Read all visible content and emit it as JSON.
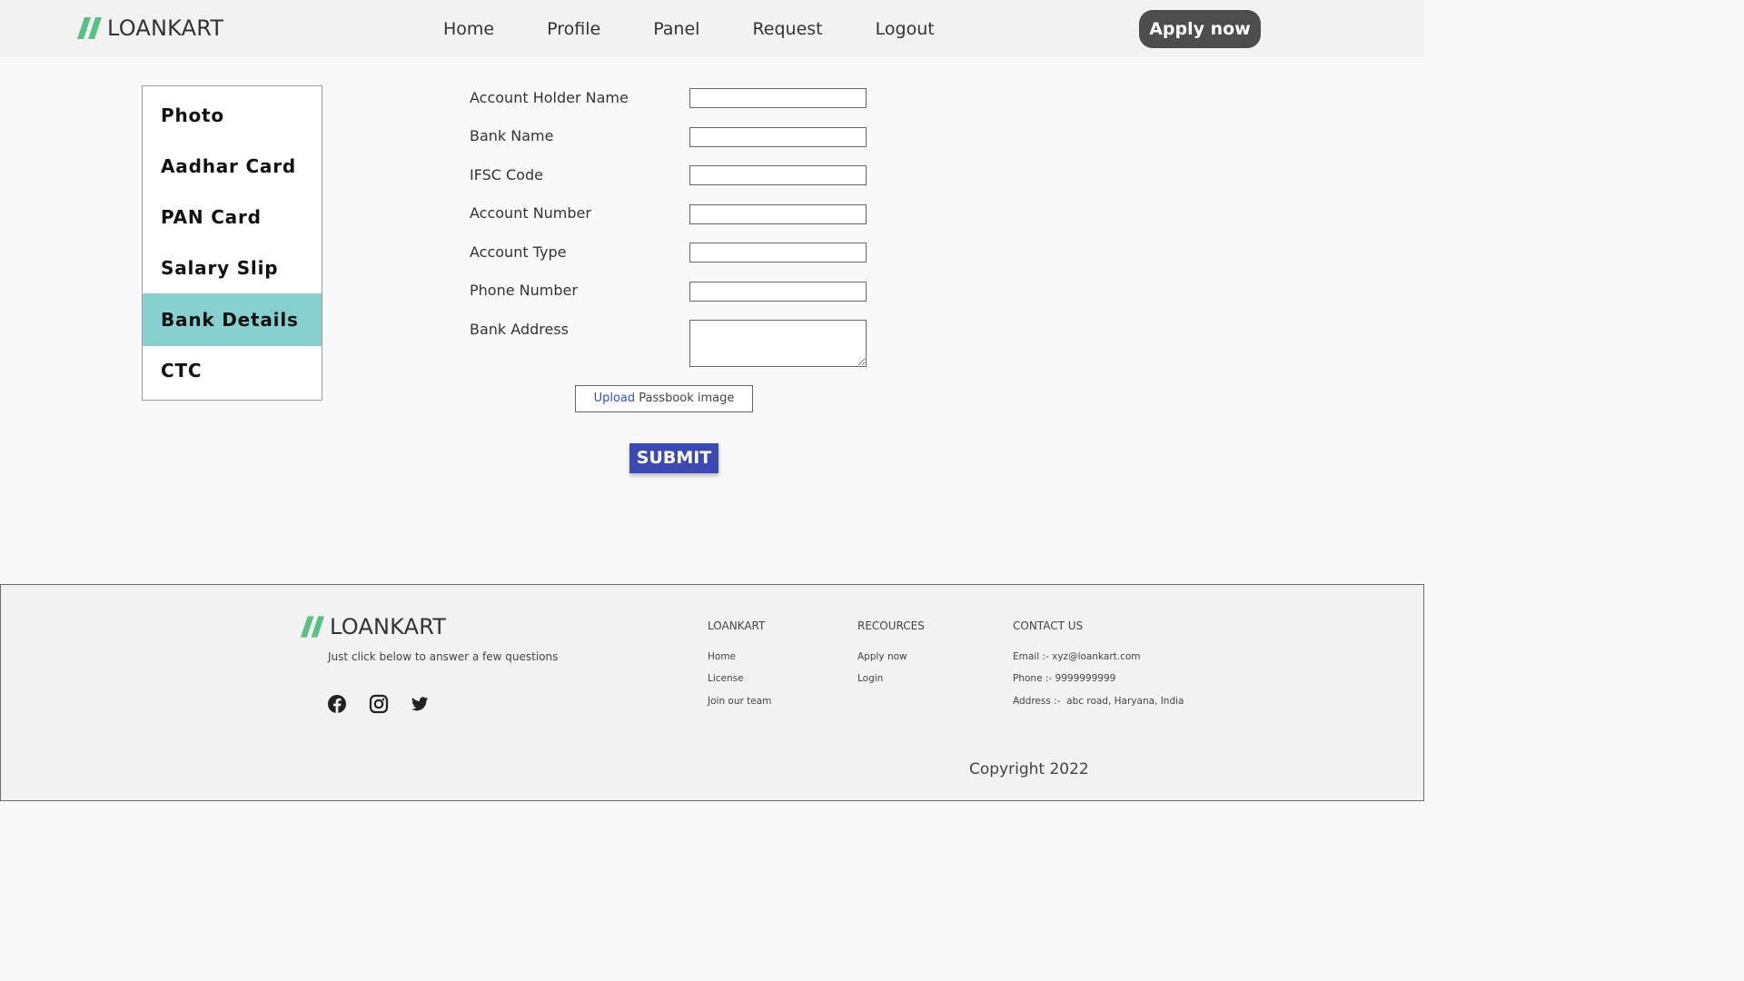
{
  "brand": {
    "name": "LOANKART",
    "accent_color": "#5bbf8a"
  },
  "nav": {
    "items": [
      "Home",
      "Profile",
      "Panel",
      "Request",
      "Logout"
    ],
    "apply_label": "Apply now"
  },
  "sidebar": {
    "items": [
      "Photo",
      "Aadhar Card",
      "PAN Card",
      "Salary Slip",
      "Bank Details",
      "CTC"
    ],
    "active": "Bank Details",
    "active_color": "#88cfcf"
  },
  "form": {
    "fields": [
      {
        "label": "Account Holder Name",
        "value": ""
      },
      {
        "label": "Bank Name",
        "value": ""
      },
      {
        "label": "IFSC Code",
        "value": ""
      },
      {
        "label": "Account Number",
        "value": ""
      },
      {
        "label": "Account Type",
        "value": ""
      },
      {
        "label": "Phone Number",
        "value": ""
      },
      {
        "label": "Bank Address",
        "value": ""
      }
    ],
    "upload": {
      "link_text": "Upload",
      "rest_text": "Passbook image"
    },
    "submit_label": "SUBMIT",
    "submit_color": "#3c48b4"
  },
  "footer": {
    "tagline": "Just click below to answer a few questions",
    "social": [
      "facebook-icon",
      "instagram-icon",
      "twitter-icon"
    ],
    "columns": [
      {
        "title": "LOANKART",
        "links": [
          "Home",
          "License",
          "Join our team"
        ]
      },
      {
        "title": "RECOURCES",
        "links": [
          "Apply now",
          "Login"
        ]
      }
    ],
    "contact": {
      "title": "CONTACT US",
      "email": "Email :- xyz@loankart.com",
      "phone": "Phone :- 9999999999",
      "address": "Address :-  abc road, Haryana, India"
    },
    "copyright": "Copyright 2022"
  }
}
